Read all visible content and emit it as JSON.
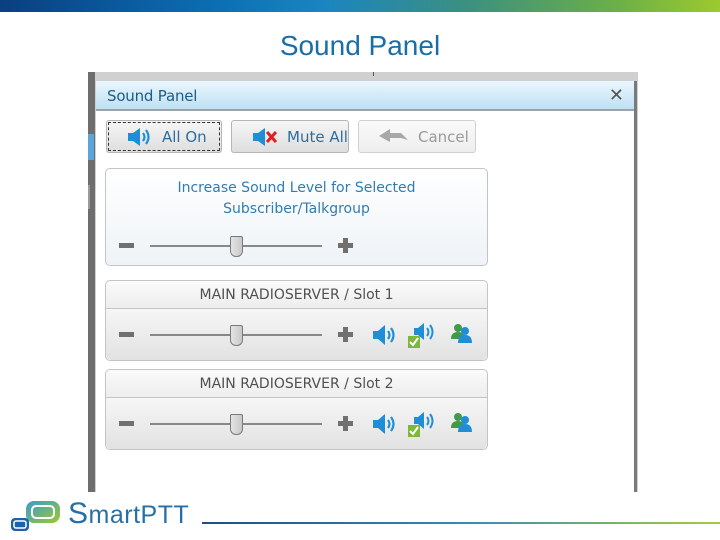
{
  "slide": {
    "title": "Sound Panel",
    "footer_brand_initial": "S",
    "footer_brand_rest": "martPTT"
  },
  "window": {
    "title": "Sound Panel",
    "close_icon": "close-icon"
  },
  "toolbar": {
    "all_on_label": "All On",
    "all_on_icon": "speaker-icon",
    "mute_all_label": "Mute All",
    "mute_all_icon": "speaker-muted-icon",
    "cancel_label": "Cancel",
    "cancel_icon": "undo-arrow-icon"
  },
  "main_panel": {
    "title_line1": "Increase Sound Level for Selected",
    "title_line2": "Subscriber/Talkgroup",
    "volume_percent": 50
  },
  "slots": [
    {
      "label": "MAIN RADIOSERVER / Slot 1",
      "volume_percent": 50,
      "icons": [
        "speaker-icon",
        "speaker-checked-icon",
        "users-icon"
      ]
    },
    {
      "label": "MAIN RADIOSERVER / Slot 2",
      "volume_percent": 50,
      "icons": [
        "speaker-icon",
        "speaker-checked-icon",
        "users-icon"
      ]
    }
  ],
  "colors": {
    "accent": "#2f7db3",
    "title_blue": "#1a6ea8",
    "mute_red": "#e02020",
    "check_green": "#7cb83a"
  }
}
